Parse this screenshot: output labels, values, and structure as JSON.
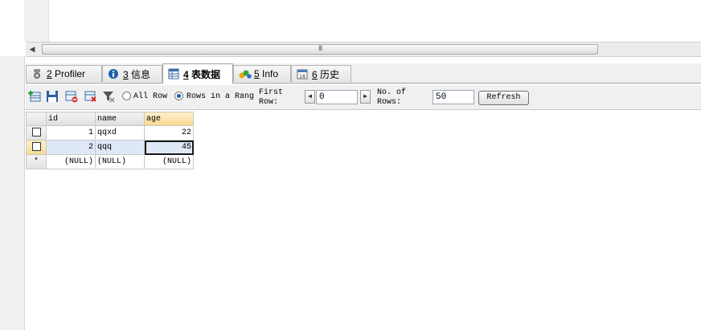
{
  "tabs": [
    {
      "num": "2",
      "label": "Profiler",
      "icon": "profiler-icon"
    },
    {
      "num": "3",
      "label": "信息",
      "icon": "info-icon"
    },
    {
      "num": "4",
      "label": "表数据",
      "icon": "table-data-icon",
      "active": true
    },
    {
      "num": "5",
      "label": "Info",
      "icon": "chart-info-icon"
    },
    {
      "num": "6",
      "label": "历史",
      "icon": "calendar-history-icon"
    }
  ],
  "toolbar": {
    "all_rows_label": "All Row",
    "rows_range_label": "Rows in a Rang",
    "first_row_label_1": "First",
    "first_row_label_2": "Row:",
    "first_row_value": "0",
    "num_rows_label_1": "No. of",
    "num_rows_label_2": "Rows:",
    "num_rows_value": "50",
    "refresh_label": "Refresh",
    "selected_mode": "rows_in_range"
  },
  "grid": {
    "columns": [
      "id",
      "name",
      "age"
    ],
    "rows": [
      {
        "id": "1",
        "name": "qqxd",
        "age": "22"
      },
      {
        "id": "2",
        "name": "qqq",
        "age": "45"
      }
    ],
    "new_row_marker": "*",
    "null_text": "(NULL)"
  },
  "scrollbar": {
    "grip": "III"
  }
}
